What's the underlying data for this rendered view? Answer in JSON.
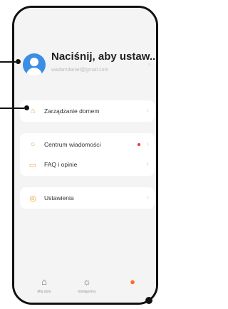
{
  "profile": {
    "name": "Naciśnij, aby ustaw...",
    "email": "wadamdaniel@gmail.com"
  },
  "menu": {
    "home": "Zarządzanie domem",
    "messages": "Centrum wiadomości",
    "faq": "FAQ i opinie",
    "settings": "Ustawienia"
  },
  "tabs": [
    {
      "label": "Mój dom",
      "icon": "home-icon"
    },
    {
      "label": "Inteligentny",
      "icon": "sun-icon"
    },
    {
      "label": "",
      "icon": "profile-icon"
    }
  ],
  "colors": {
    "accent": "#ff6a2a",
    "avatar": "#3a8ee6",
    "badge": "#e53935"
  }
}
